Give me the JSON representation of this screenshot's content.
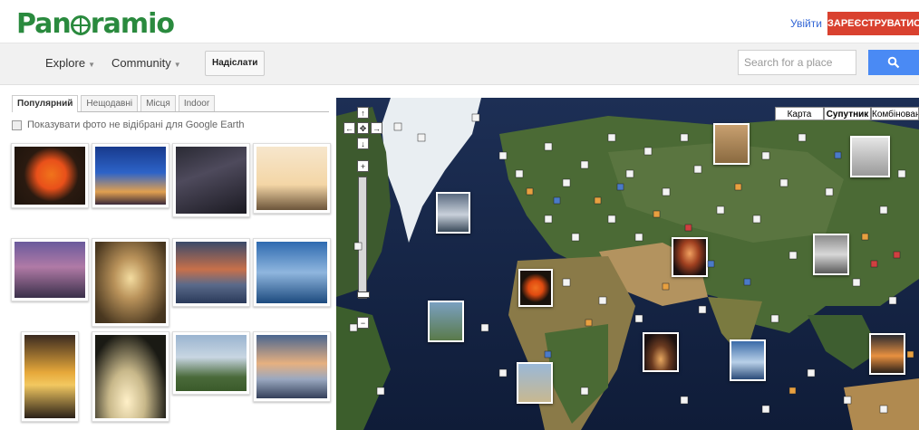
{
  "header": {
    "logo_text_left": "Pan",
    "logo_text_right": "ramio",
    "signin_label": "Увійти",
    "register_label": "ЗАРЕЄСТРУВАТИСЯ",
    "brand_color": "#2a8a3e",
    "register_color": "#d9412f"
  },
  "nav": {
    "explore_label": "Explore",
    "community_label": "Community",
    "upload_label": "Надіслати",
    "search_placeholder": "Search for a place",
    "search_button_icon": "search-icon",
    "search_button_color": "#4a8af4"
  },
  "tabs": [
    {
      "label": "Популярний",
      "active": true
    },
    {
      "label": "Нещодавні",
      "active": false
    },
    {
      "label": "Місця",
      "active": false
    },
    {
      "label": "Indoor",
      "active": false
    }
  ],
  "filter": {
    "checkbox_label": "Показувати фото не відібрані для Google Earth",
    "checked": false
  },
  "map": {
    "type_buttons": [
      {
        "label": "Карта",
        "selected": false
      },
      {
        "label": "Супутник",
        "selected": true
      },
      {
        "label": "Комбінован",
        "selected": false
      }
    ],
    "nav_controls": [
      "pan-up-icon",
      "pan-left-icon",
      "pan-center-icon",
      "pan-right-icon",
      "pan-down-icon",
      "zoom-in-icon",
      "zoom-out-icon"
    ]
  },
  "photos": [
    {
      "subject": "spider silhouette on orange sun"
    },
    {
      "subject": "camel caravan at dusk"
    },
    {
      "subject": "lightning storm over city"
    },
    {
      "subject": "tree house on hill"
    },
    {
      "subject": "purple sky with birds"
    },
    {
      "subject": "tunnel of trees road"
    },
    {
      "subject": "storm cloud over lake"
    },
    {
      "subject": "blue misty mountains"
    },
    {
      "subject": "golden sunset over lake"
    },
    {
      "subject": "deer under tree silhouette"
    },
    {
      "subject": "alpine church and mountains"
    },
    {
      "subject": "sunset clouds over lake"
    }
  ]
}
